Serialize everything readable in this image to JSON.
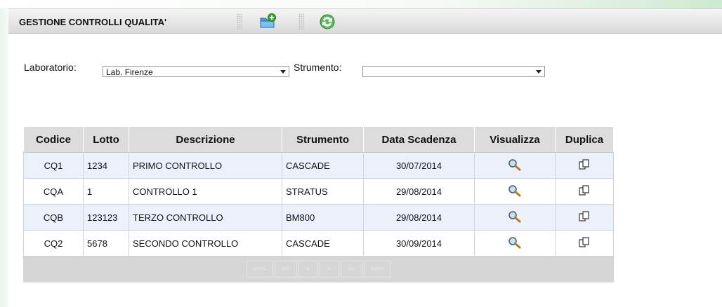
{
  "toolbar": {
    "title": "GESTIONE CONTROLLI QUALITA'",
    "icons": [
      "new-folder-icon",
      "refresh-icon"
    ]
  },
  "filters": {
    "laboratorio_label": "Laboratorio:",
    "laboratorio_value": "Lab. Firenze",
    "strumento_label": "Strumento:",
    "strumento_value": ""
  },
  "table": {
    "headers": [
      "Codice",
      "Lotto",
      "Descrizione",
      "Strumento",
      "Data Scadenza",
      "Visualizza",
      "Duplica"
    ],
    "rows": [
      {
        "codice": "CQ1",
        "lotto": "1234",
        "descrizione": "PRIMO CONTROLLO",
        "strumento": "CASCADE",
        "data_scadenza": "30/07/2014"
      },
      {
        "codice": "CQA",
        "lotto": "1",
        "descrizione": "CONTROLLO 1",
        "strumento": "STRATUS",
        "data_scadenza": "29/08/2014"
      },
      {
        "codice": "CQB",
        "lotto": "123123",
        "descrizione": "TERZO CONTROLLO",
        "strumento": "BM800",
        "data_scadenza": "29/08/2014"
      },
      {
        "codice": "CQ2",
        "lotto": "5678",
        "descrizione": "SECONDO CONTROLLO",
        "strumento": "CASCADE",
        "data_scadenza": "30/09/2014"
      }
    ],
    "row_icons": {
      "visualizza": "magnifier-icon",
      "duplica": "duplicate-icon"
    }
  },
  "pager": {
    "first": "<<<<",
    "prev_block": "<<",
    "prev": "<",
    "next": ">",
    "next_block": ">>",
    "last": ">>>>"
  },
  "colors": {
    "toolbar_bg": "#e6e6e6",
    "header_bg": "#dcdcdc",
    "row_alt_bg": "#ecf0fb",
    "pager_bg": "#d6d6d6"
  }
}
